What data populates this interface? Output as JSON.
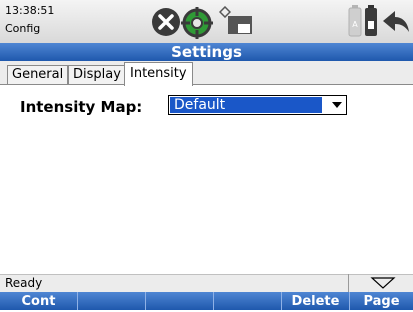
{
  "statusbar": {
    "time": "13:38:51",
    "mode": "Config",
    "icons": [
      "close-circle-icon",
      "target-icon",
      "diamond-icon",
      "monitor-icon",
      "battery-icon",
      "back-arrow-icon"
    ]
  },
  "header": {
    "title": "Settings"
  },
  "tabs": [
    {
      "label": "General"
    },
    {
      "label": "Display"
    },
    {
      "label": "Intensity"
    }
  ],
  "form": {
    "intensity_map_label": "Intensity Map:",
    "intensity_map_value": "Default"
  },
  "status": {
    "text": "Ready"
  },
  "softkeys": [
    {
      "label": "Cont"
    },
    {
      "label": ""
    },
    {
      "label": ""
    },
    {
      "label": ""
    },
    {
      "label": "Delete"
    },
    {
      "label": "Page"
    }
  ],
  "colors": {
    "accent": "#1f58ad",
    "selection": "#1a57c8"
  }
}
